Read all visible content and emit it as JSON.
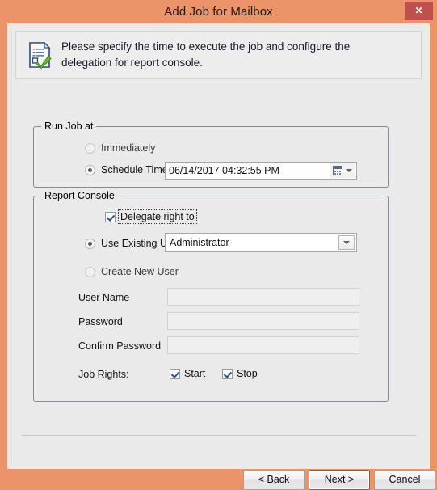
{
  "window": {
    "title": "Add Job for Mailbox",
    "close_label": "✕",
    "titlebar_color": "#ec9469",
    "close_button_color": "#c0504d",
    "client_background": "#eaeaea"
  },
  "header": {
    "icon": "document-check-icon",
    "message_line1": "Please specify the time to execute the job and configure the",
    "message_line2": "delegation for report console."
  },
  "run_job_group": {
    "title": "Run Job at",
    "options": [
      {
        "label": "Immediately",
        "selected": false,
        "enabled": false
      },
      {
        "label": "Schedule Time",
        "selected": true,
        "enabled": true
      }
    ],
    "schedule_datetime": "06/14/2017 04:32:55 PM",
    "datetime_icon": "calendar-icon",
    "datetime_dropdown_icon": "chevron-down-icon"
  },
  "report_console_group": {
    "title": "Report Console",
    "delegate_checkbox": {
      "label": "Delegate right to",
      "checked": true,
      "focused": true
    },
    "user_mode_options": [
      {
        "label": "Use Existing User",
        "selected": true
      },
      {
        "label": "Create New User",
        "selected": false
      }
    ],
    "existing_user_combo": {
      "value": "Administrator",
      "arrow_icon": "chevron-down-icon"
    },
    "new_user_fields": [
      {
        "label": "User Name",
        "value": "",
        "enabled": false
      },
      {
        "label": "Password",
        "value": "",
        "enabled": false
      },
      {
        "label": "Confirm Password",
        "value": "",
        "enabled": false
      }
    ],
    "job_rights": {
      "label": "Job Rights:",
      "items": [
        {
          "label": "Start",
          "checked": true
        },
        {
          "label": "Stop",
          "checked": true
        }
      ]
    }
  },
  "footer": {
    "buttons": [
      {
        "name": "back",
        "label": "< Back",
        "default": false
      },
      {
        "name": "next",
        "label": "Next >",
        "default": true
      },
      {
        "name": "cancel",
        "label": "Cancel",
        "default": false
      }
    ]
  }
}
